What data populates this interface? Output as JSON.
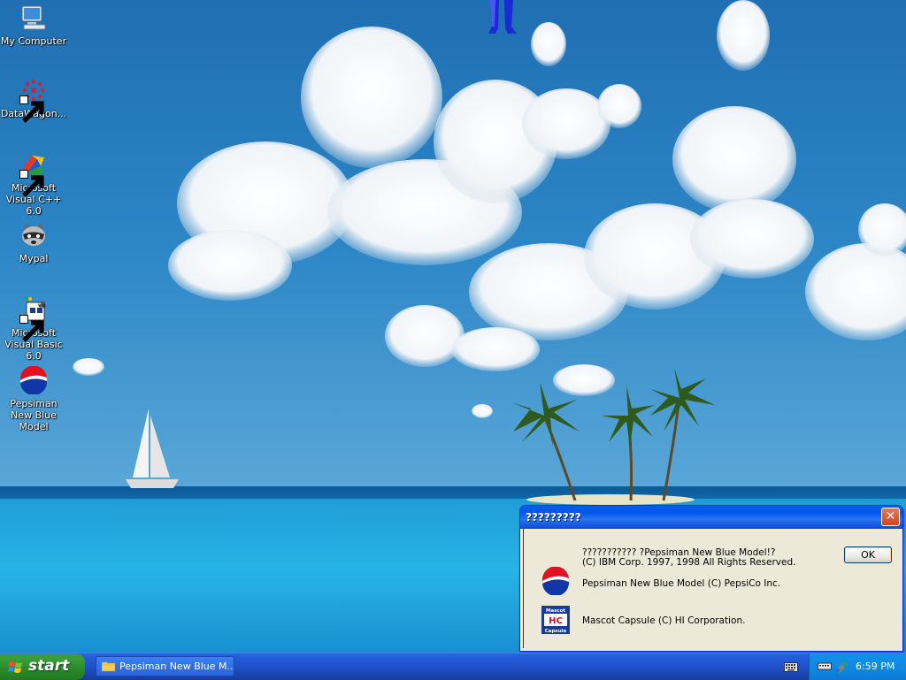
{
  "desktop": {
    "icons": [
      {
        "label": "My Computer",
        "icon": "my-computer-icon",
        "shortcut": false
      },
      {
        "label": "DataWagon...",
        "icon": "datawagon-icon",
        "shortcut": true
      },
      {
        "label": "Microsoft Visual C++ 6.0",
        "icon": "visual-cpp-icon",
        "shortcut": true
      },
      {
        "label": "Mypal",
        "icon": "mypal-raccoon-icon",
        "shortcut": false
      },
      {
        "label": "Microsoft Visual Basic 6.0",
        "icon": "visual-basic-icon",
        "shortcut": true
      },
      {
        "label": "Pepsiman New Blue Model",
        "icon": "pepsi-logo-icon",
        "shortcut": false
      }
    ]
  },
  "dialog": {
    "title": "?????????",
    "close_label": "✕",
    "line1": "??????????? ?Pepsiman New Blue Model!?",
    "line2": "(C) IBM Corp. 1997, 1998 All Rights Reserved.",
    "line3": "Pepsiman New Blue Model (C) PepsiCo Inc.",
    "line4": "Mascot Capsule (C) HI Corporation.",
    "ok_label": "OK",
    "mascot_capsule_logo_text": "Mascot HC Capsule"
  },
  "taskbar": {
    "start_label": "start",
    "task_button_label": "Pepsiman New Blue M...",
    "clock": "6:59 PM"
  },
  "colors": {
    "taskbar_blue": "#245edb",
    "start_green": "#389e38",
    "dialog_face": "#ece9d8",
    "title_blue": "#0058ee",
    "close_red": "#d4421c",
    "tray_blue": "#0f8ae3"
  }
}
